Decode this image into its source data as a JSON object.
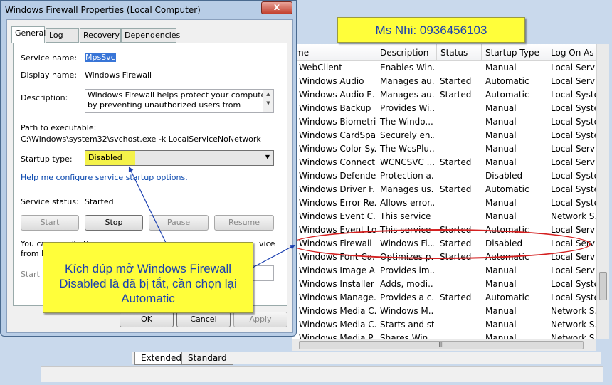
{
  "dialog": {
    "title": "Windows Firewall Properties (Local Computer)",
    "close_glyph": "x",
    "tabs": [
      "General",
      "Log On",
      "Recovery",
      "Dependencies"
    ],
    "service_name_label": "Service name:",
    "service_name": "MpsSvc",
    "display_name_label": "Display name:",
    "display_name": "Windows Firewall",
    "description_label": "Description:",
    "description": "Windows Firewall helps protect your computer by preventing unauthorized users from gaining access",
    "path_label": "Path to executable:",
    "path": "C:\\Windows\\system32\\svchost.exe -k LocalServiceNoNetwork",
    "startup_type_label": "Startup type:",
    "startup_type": "Disabled",
    "help_link": "Help me configure service startup options.",
    "service_status_label": "Service status:",
    "service_status": "Started",
    "start_btn": "Start",
    "stop_btn": "Stop",
    "pause_btn": "Pause",
    "resume_btn": "Resume",
    "specify_text_1": "You can specify th",
    "specify_text_2": "from he",
    "specify_text_right": "vice",
    "start_params_label": "Start p",
    "ok_btn": "OK",
    "cancel_btn": "Cancel",
    "apply_btn": "Apply"
  },
  "services": {
    "columns": [
      "me",
      "Description",
      "Status",
      "Startup Type",
      "Log On As"
    ],
    "rows": [
      [
        "WebClient",
        "Enables Win...",
        "",
        "Manual",
        "Local Servic"
      ],
      [
        "Windows Audio",
        "Manages au...",
        "Started",
        "Automatic",
        "Local Servic"
      ],
      [
        "Windows Audio E...",
        "Manages au...",
        "Started",
        "Automatic",
        "Local Syste."
      ],
      [
        "Windows Backup",
        "Provides Wi...",
        "",
        "Manual",
        "Local Syste."
      ],
      [
        "Windows Biometri...",
        "The Windo...",
        "",
        "Manual",
        "Local Syste."
      ],
      [
        "Windows CardSpa...",
        "Securely en...",
        "",
        "Manual",
        "Local Syste."
      ],
      [
        "Windows Color Sy...",
        "The WcsPlu...",
        "",
        "Manual",
        "Local Servic"
      ],
      [
        "Windows Connect...",
        "WCNCSVC ...",
        "Started",
        "Manual",
        "Local Servic"
      ],
      [
        "Windows Defender",
        "Protection a...",
        "",
        "Disabled",
        "Local Syste."
      ],
      [
        "Windows Driver F...",
        "Manages us...",
        "Started",
        "Automatic",
        "Local Syste."
      ],
      [
        "Windows Error Re...",
        "Allows error...",
        "",
        "Manual",
        "Local Syste."
      ],
      [
        "Windows Event C...",
        "This service ...",
        "",
        "Manual",
        "Network S..."
      ],
      [
        "Windows Event Log",
        "This service ...",
        "Started",
        "Automatic",
        "Local Servic"
      ],
      [
        "Windows Firewall",
        "Windows Fi...",
        "Started",
        "Disabled",
        "Local Servic"
      ],
      [
        "Windows Font Ca...",
        "Optimizes p...",
        "Started",
        "Automatic",
        "Local Servic"
      ],
      [
        "Windows Image A...",
        "Provides im...",
        "",
        "Manual",
        "Local Servic"
      ],
      [
        "Windows Installer",
        "Adds, modi...",
        "",
        "Manual",
        "Local Syste."
      ],
      [
        "Windows Manage...",
        "Provides a c...",
        "Started",
        "Automatic",
        "Local Syste."
      ],
      [
        "Windows Media C...",
        "Windows M...",
        "",
        "Manual",
        "Network S..."
      ],
      [
        "Windows Media C...",
        "Starts and st...",
        "",
        "Manual",
        "Network S..."
      ],
      [
        "Windows Media P...",
        "Shares Win...",
        "",
        "Manual",
        "Network S..."
      ]
    ],
    "bottom_tabs": [
      "Extended",
      "Standard"
    ],
    "hscroll_grip": "III"
  },
  "callouts": {
    "phone": "Ms Nhi: 0936456103",
    "instruction": "Kích đúp mở Windows Firewall Disabled là đã bị tắt, cần chọn lại Automatic"
  },
  "colors": {
    "note_bg": "#fffe3a",
    "note_text": "#1a3fb0",
    "highlight": "#d42020",
    "link": "#0645ad"
  }
}
